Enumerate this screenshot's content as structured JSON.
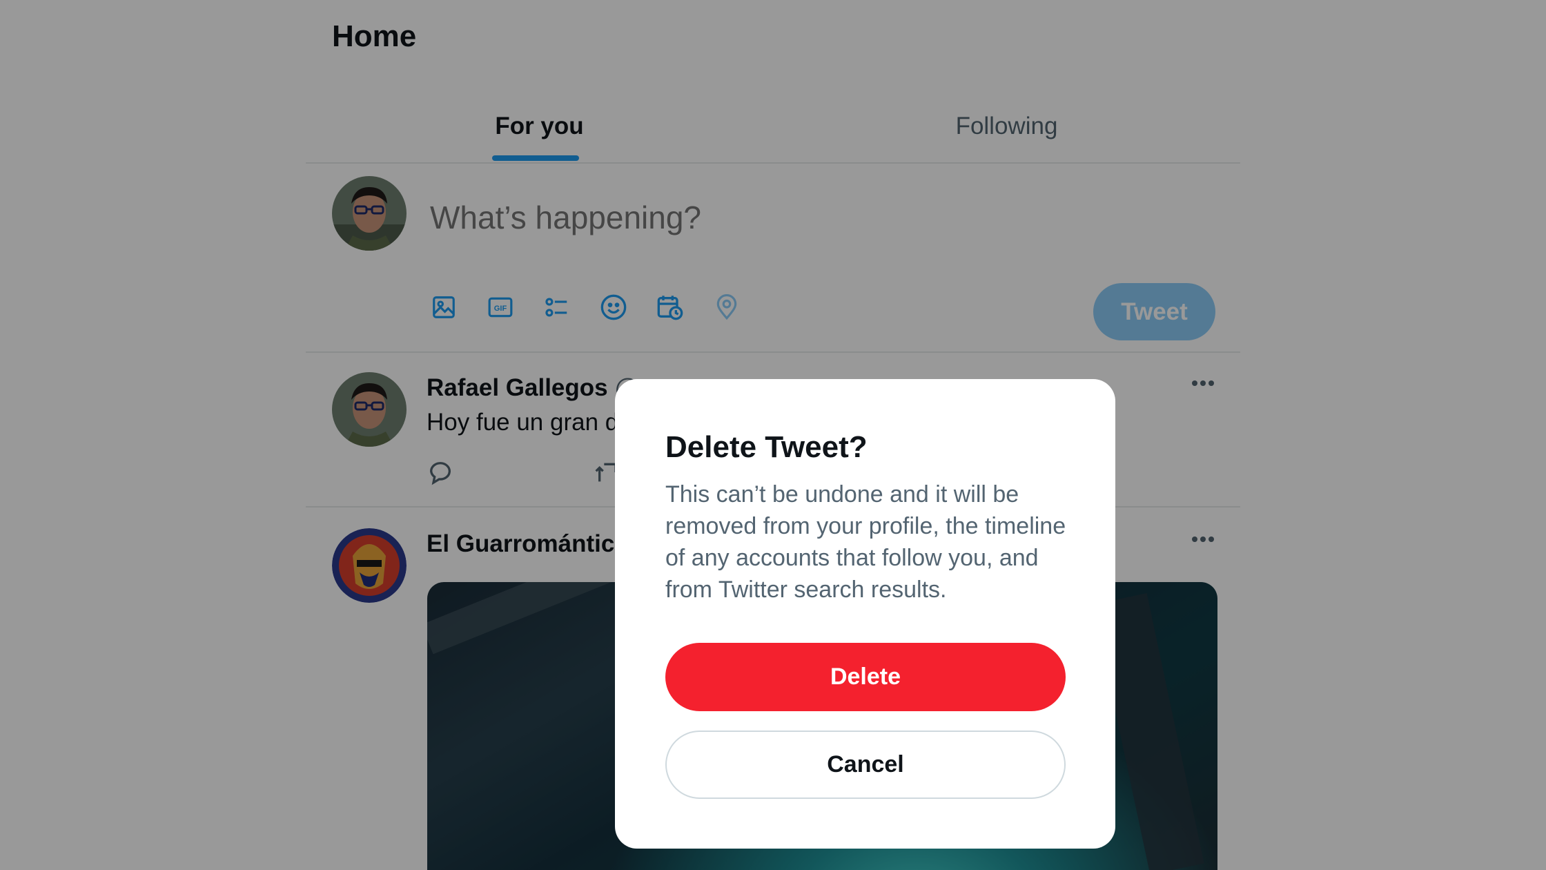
{
  "header": {
    "title": "Home"
  },
  "tabs": [
    {
      "label": "For you",
      "active": true
    },
    {
      "label": "Following",
      "active": false
    }
  ],
  "composer": {
    "placeholder": "What’s happening?",
    "tools": [
      "image-icon",
      "gif-icon",
      "poll-icon",
      "emoji-icon",
      "schedule-icon",
      "location-icon"
    ],
    "tweet_label": "Tweet"
  },
  "posts": [
    {
      "author": "Rafael Gallegos",
      "handle": "@",
      "text": "Hoy fue un gran d"
    },
    {
      "author": "El Guarrománticc",
      "handle": "",
      "text": ""
    }
  ],
  "dialog": {
    "title": "Delete Tweet?",
    "body": "This can’t be undone and it will be removed from your profile, the timeline of any accounts that follow you, and from Twitter search results.",
    "delete_label": "Delete",
    "cancel_label": "Cancel"
  },
  "colors": {
    "accent": "#1d9bf0",
    "danger": "#f4212e",
    "text_primary": "#0f1419",
    "text_secondary": "#536471"
  }
}
